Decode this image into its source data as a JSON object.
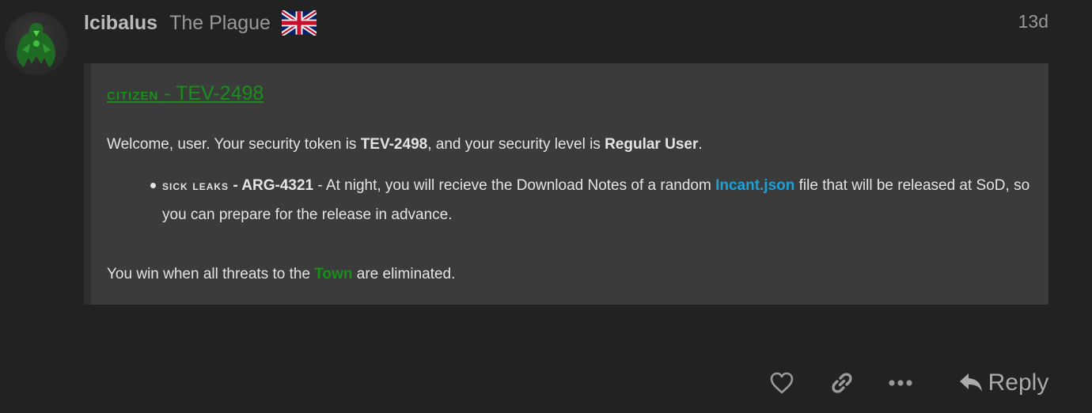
{
  "post": {
    "username": "lcibalus",
    "user_title": "The Plague",
    "date": "13d",
    "flag_icon": "uk-flag-icon",
    "avatar_icon": "green-figure-avatar"
  },
  "quote": {
    "heading_role": "citizen",
    "heading_separator": " - ",
    "heading_token": "TEV-2498",
    "welcome": {
      "prefix": "Welcome, user. Your security token is ",
      "token": "TEV-2498",
      "middle": ", and your security level is ",
      "level": "Regular User",
      "suffix": "."
    },
    "ability": {
      "name": "sick leaks",
      "separator": " - ",
      "code": "ARG-4321",
      "text_before": " - At night, you will recieve the Download Notes of a random ",
      "link": "Incant.json",
      "text_after": " file that will be released at SoD, so you can prepare for the release in advance."
    },
    "win": {
      "prefix": "You win when all threats to the ",
      "faction": "Town",
      "suffix": " are eliminated."
    }
  },
  "actions": {
    "reply_label": "Reply",
    "like_icon": "heart-icon",
    "share_icon": "link-icon",
    "more_icon": "ellipsis-icon",
    "reply_icon": "reply-arrow-icon"
  },
  "colors": {
    "background": "#222222",
    "quote_background": "#3b3b3b",
    "town_green": "#17901a",
    "link_blue": "#1ea0d6",
    "muted_text": "#999999"
  }
}
